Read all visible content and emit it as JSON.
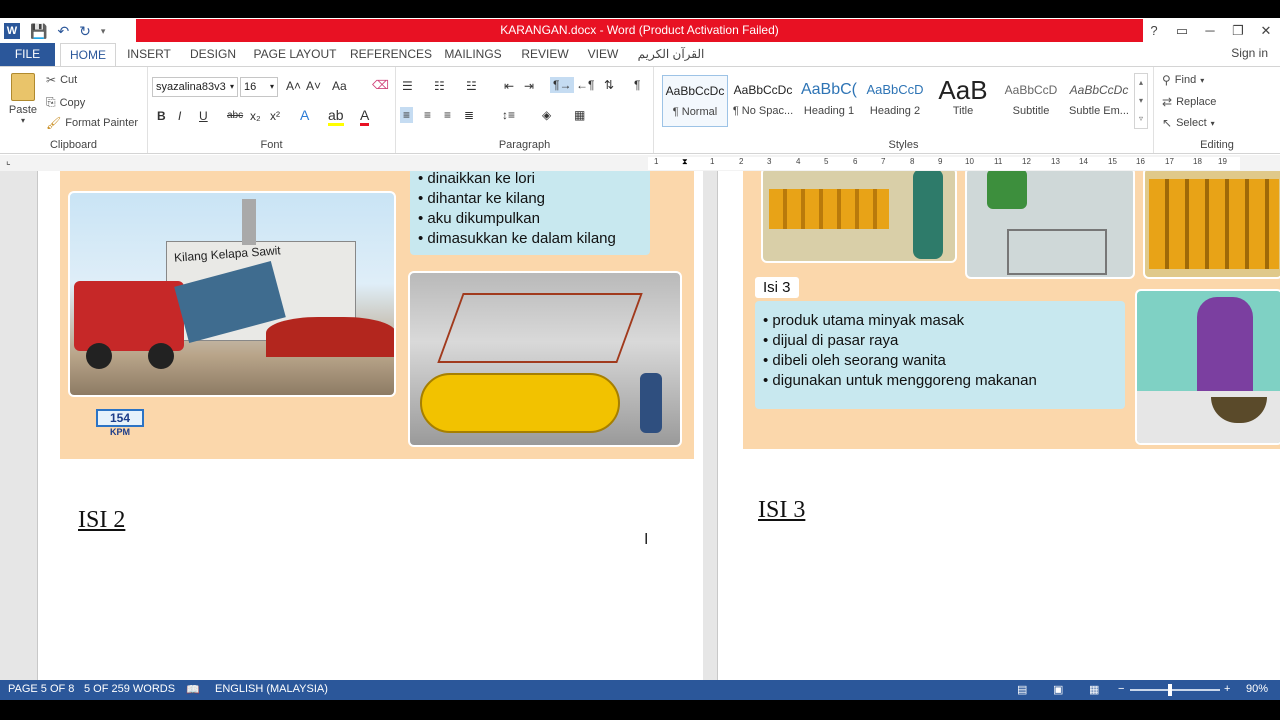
{
  "window": {
    "title": "KARANGAN.docx -  Word (Product Activation Failed)",
    "controls": [
      "?",
      "▭",
      "─",
      "❐",
      "✕"
    ]
  },
  "tabs": [
    "FILE",
    "HOME",
    "INSERT",
    "DESIGN",
    "PAGE LAYOUT",
    "REFERENCES",
    "MAILINGS",
    "REVIEW",
    "VIEW",
    "القرآن الكريم"
  ],
  "signin": "Sign in",
  "clipboard": {
    "paste": "Paste",
    "cut": "Cut",
    "copy": "Copy",
    "format_painter": "Format Painter",
    "label": "Clipboard"
  },
  "font": {
    "name": "syazalina83v3",
    "size": "16",
    "label": "Font",
    "bold": "B",
    "italic": "I",
    "underline": "U",
    "strike": "abc",
    "sub": "x₂",
    "sup": "x²",
    "grow": "A˄",
    "shrink": "A˅",
    "case": "Aa"
  },
  "paragraph": {
    "label": "Paragraph"
  },
  "styles": {
    "label": "Styles",
    "items": [
      {
        "sample": "AaBbCcDc",
        "name": "¶ Normal"
      },
      {
        "sample": "AaBbCcDc",
        "name": "¶ No Spac..."
      },
      {
        "sample": "AaBbC(",
        "name": "Heading 1"
      },
      {
        "sample": "AaBbCcD",
        "name": "Heading 2"
      },
      {
        "sample": "AaB",
        "name": "Title"
      },
      {
        "sample": "AaBbCcD",
        "name": "Subtitle"
      },
      {
        "sample": "AaBbCcDc",
        "name": "Subtle Em..."
      }
    ]
  },
  "editing": {
    "find": "Find",
    "replace": "Replace",
    "select": "Select",
    "label": "Editing"
  },
  "ruler_numbers": [
    "1",
    "1",
    "2",
    "3",
    "4",
    "5",
    "6",
    "7",
    "8",
    "9",
    "10",
    "11",
    "12",
    "13",
    "14",
    "15",
    "16",
    "17",
    "18",
    "19"
  ],
  "document": {
    "left_page": {
      "bullets": [
        "dinaikkan ke lori",
        "dihantar ke kilang",
        "aku dikumpulkan",
        "dimasukkan ke dalam kilang"
      ],
      "sign_text": "Kilang Kelapa Sawit",
      "logo_number": "154",
      "logo_text": "KPM",
      "heading": "ISI  2"
    },
    "right_page": {
      "isi_label": "Isi 3",
      "bullets": [
        "produk utama minyak masak",
        "dijual di pasar raya",
        "dibeli oleh seorang wanita",
        "digunakan untuk menggoreng makanan"
      ],
      "heading": "ISI  3"
    }
  },
  "status": {
    "page": "PAGE 5 OF 8",
    "words": "5 OF 259 WORDS",
    "language": "ENGLISH (MALAYSIA)",
    "zoom": "90%"
  }
}
